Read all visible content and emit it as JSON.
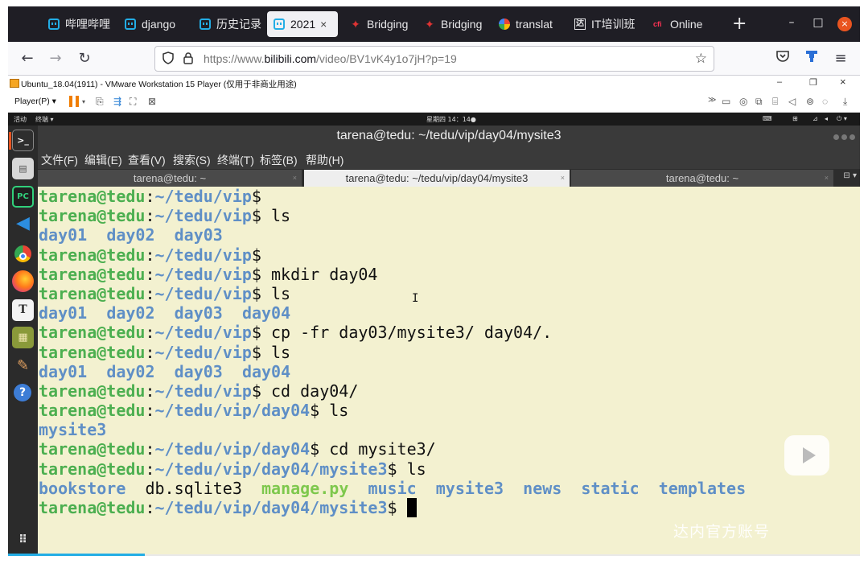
{
  "browser": {
    "tabs": [
      {
        "icon": "bilibili-icon",
        "label": "哔哩哔哩"
      },
      {
        "icon": "bilibili-icon",
        "label": "django"
      },
      {
        "icon": "bilibili-icon",
        "label": "历史记录"
      },
      {
        "icon": "bilibili-icon",
        "label": "2021",
        "active": true
      },
      {
        "icon": "maple-leaf-icon",
        "label": "Bridging"
      },
      {
        "icon": "maple-leaf-icon",
        "label": "Bridging"
      },
      {
        "icon": "google-icon",
        "label": "translat"
      },
      {
        "icon": "tarena-icon",
        "label": "IT培训班"
      },
      {
        "icon": "cfi-icon",
        "label": "Online"
      }
    ],
    "tab_close": "×",
    "new_tab": "+",
    "window_controls": {
      "minimize": "–",
      "maximize": "□",
      "close": "×"
    },
    "nav": {
      "back": "←",
      "forward": "→",
      "reload": "↻"
    },
    "url": {
      "scheme": "https://www.",
      "host": "bilibili.com",
      "path": "/video/BV1vK4y1o7jH?p=19"
    }
  },
  "vmware": {
    "title": "Ubuntu_18.04(1911) - VMware Workstation 15 Player (仅用于非商业用途)",
    "player_menu": "Player(P) ▾",
    "window_controls": {
      "minimize": "–",
      "restore": "❐",
      "close": "×"
    }
  },
  "ubuntu": {
    "activities": "活动",
    "app_menu": "终端 ▾",
    "clock": "星期四 14：14●",
    "terminal": {
      "title": "tarena@tedu: ~/tedu/vip/day04/mysite3",
      "menu": [
        "文件(F)",
        "编辑(E)",
        "查看(V)",
        "搜索(S)",
        "终端(T)",
        "标签(B)",
        "帮助(H)"
      ],
      "tabs": [
        {
          "label": "tarena@tedu: ~"
        },
        {
          "label": "tarena@tedu: ~/tedu/vip/day04/mysite3",
          "active": true
        },
        {
          "label": "tarena@tedu: ~"
        }
      ],
      "tab_close": "×",
      "prompt_user": "tarena@tedu",
      "lines": [
        {
          "path": "~/tedu/vip",
          "cmd": ""
        },
        {
          "path": "~/tedu/vip",
          "cmd": " ls"
        },
        {
          "output": [
            {
              "t": "day01",
              "c": "dir"
            },
            {
              "t": "day02",
              "c": "dir"
            },
            {
              "t": "day03",
              "c": "dir"
            }
          ]
        },
        {
          "path": "~/tedu/vip",
          "cmd": ""
        },
        {
          "path": "~/tedu/vip",
          "cmd": " mkdir day04"
        },
        {
          "path": "~/tedu/vip",
          "cmd": " ls"
        },
        {
          "output": [
            {
              "t": "day01",
              "c": "dir"
            },
            {
              "t": "day02",
              "c": "dir"
            },
            {
              "t": "day03",
              "c": "dir"
            },
            {
              "t": "day04",
              "c": "dir"
            }
          ]
        },
        {
          "path": "~/tedu/vip",
          "cmd": " cp -fr day03/mysite3/ day04/."
        },
        {
          "path": "~/tedu/vip",
          "cmd": " ls"
        },
        {
          "output": [
            {
              "t": "day01",
              "c": "dir"
            },
            {
              "t": "day02",
              "c": "dir"
            },
            {
              "t": "day03",
              "c": "dir"
            },
            {
              "t": "day04",
              "c": "dir"
            }
          ]
        },
        {
          "path": "~/tedu/vip",
          "cmd": " cd day04/"
        },
        {
          "path": "~/tedu/vip/day04",
          "cmd": " ls"
        },
        {
          "output": [
            {
              "t": "mysite3",
              "c": "dir"
            }
          ]
        },
        {
          "path": "~/tedu/vip/day04",
          "cmd": " cd mysite3/"
        },
        {
          "path": "~/tedu/vip/day04/mysite3",
          "cmd": " ls"
        },
        {
          "output": [
            {
              "t": "bookstore",
              "c": "dir"
            },
            {
              "t": "db.sqlite3",
              "c": "file"
            },
            {
              "t": "manage.py",
              "c": "exe"
            },
            {
              "t": "music",
              "c": "dir"
            },
            {
              "t": "mysite3",
              "c": "dir"
            },
            {
              "t": "news",
              "c": "dir"
            },
            {
              "t": "static",
              "c": "dir"
            },
            {
              "t": "templates",
              "c": "dir"
            }
          ],
          "sep": [
            "  ",
            "  ",
            "  ",
            "  ",
            "  ",
            "  ",
            "  "
          ]
        },
        {
          "path": "~/tedu/vip/day04/mysite3",
          "cmd": " ",
          "cursor": true
        }
      ]
    }
  },
  "overlay": {
    "watermark": "达内官方账号"
  },
  "colors": {
    "prompt_user": "#4caf50",
    "prompt_path": "#5f8fc6",
    "terminal_bg": "#f3f1d0",
    "ubuntu_accent": "#e95420",
    "bilibili": "#23ade5"
  }
}
